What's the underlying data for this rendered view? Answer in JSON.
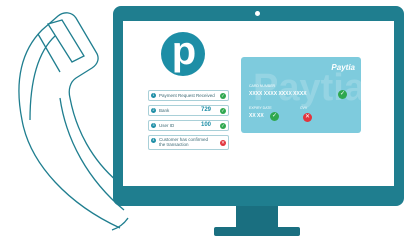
{
  "logo": {
    "text": "p"
  },
  "checklist": [
    {
      "num": "1",
      "label": "Payment Request Received",
      "value": "",
      "status": "ok"
    },
    {
      "num": "2",
      "label": "Bank",
      "value": "729",
      "status": "ok"
    },
    {
      "num": "3",
      "label": "User ID",
      "value": "100",
      "status": "ok"
    },
    {
      "num": "4",
      "label": "Customer has confirmed the transaction",
      "value": "",
      "status": "bad"
    }
  ],
  "card": {
    "brand": "Paytia",
    "watermark": "Paytia",
    "number_label": "CARD NUMBER",
    "number_value": "XXXX XXXX XXXX XXXX",
    "expiry_label": "EXPIRY DATE",
    "expiry_value": "XX XX",
    "cvv_label": "CVV"
  },
  "colors": {
    "monitor": "#1f7e8f",
    "card": "#7ecbdd",
    "ok": "#2fa84f",
    "bad": "#e2343d",
    "brand": "#1d8ea6"
  },
  "icons": {
    "ok": "check-icon",
    "bad": "cross-icon"
  }
}
